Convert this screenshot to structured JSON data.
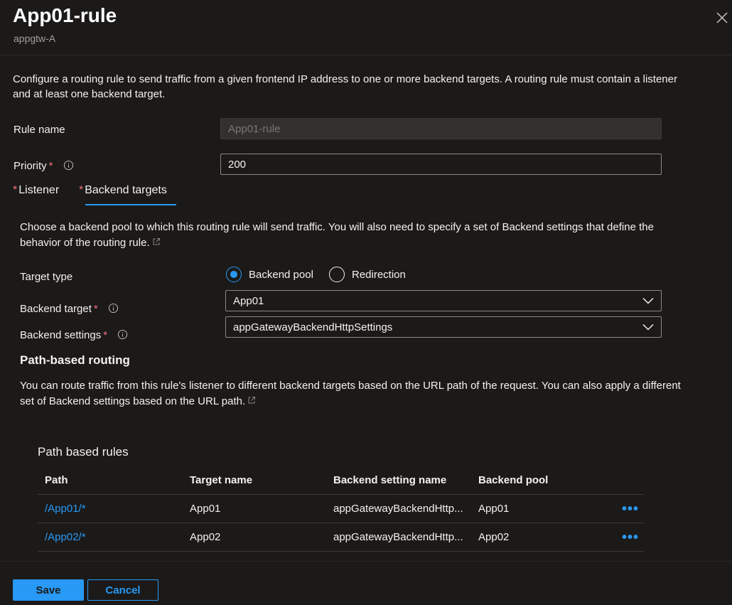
{
  "header": {
    "title": "App01-rule",
    "subtitle": "appgtw-A",
    "close_icon": "close-icon"
  },
  "description": "Configure a routing rule to send traffic from a given frontend IP address to one or more backend targets. A routing rule must contain a listener and at least one backend target.",
  "rule_name": {
    "label": "Rule name",
    "value": "App01-rule",
    "disabled": true
  },
  "priority": {
    "label": "Priority",
    "required_mark": "*",
    "value": "200",
    "info_icon": "info-icon"
  },
  "tabs": [
    {
      "label": "Listener",
      "required_mark": "*",
      "selected": false
    },
    {
      "label": "Backend targets",
      "required_mark": "*",
      "selected": true
    }
  ],
  "backend_tab": {
    "description": "Choose a backend pool to which this routing rule will send traffic. You will also need to specify a set of Backend settings that define the behavior of the routing rule.",
    "target_type": {
      "label": "Target type",
      "options": [
        {
          "label": "Backend pool",
          "selected": true
        },
        {
          "label": "Redirection",
          "selected": false
        }
      ]
    },
    "backend_target": {
      "label": "Backend target",
      "required_mark": "*",
      "value": "App01"
    },
    "backend_settings": {
      "label": "Backend settings",
      "required_mark": "*",
      "value": "appGatewayBackendHttpSettings"
    }
  },
  "path_routing": {
    "heading": "Path-based routing",
    "description": "You can route traffic from this rule's listener to different backend targets based on the URL path of the request. You can also apply a different set of Backend settings based on the URL path.",
    "table_title": "Path based rules",
    "columns": [
      "Path",
      "Target name",
      "Backend setting name",
      "Backend pool"
    ],
    "rows": [
      {
        "path": "/App01/*",
        "target": "App01",
        "setting": "appGatewayBackendHttp...",
        "pool": "App01",
        "more": "•••"
      },
      {
        "path": "/App02/*",
        "target": "App02",
        "setting": "appGatewayBackendHttp...",
        "pool": "App02",
        "more": "•••"
      }
    ]
  },
  "footer": {
    "save_label": "Save",
    "cancel_label": "Cancel"
  },
  "colors": {
    "accent": "#2899f5",
    "required": "#f1707b",
    "background": "#1b1a19"
  }
}
